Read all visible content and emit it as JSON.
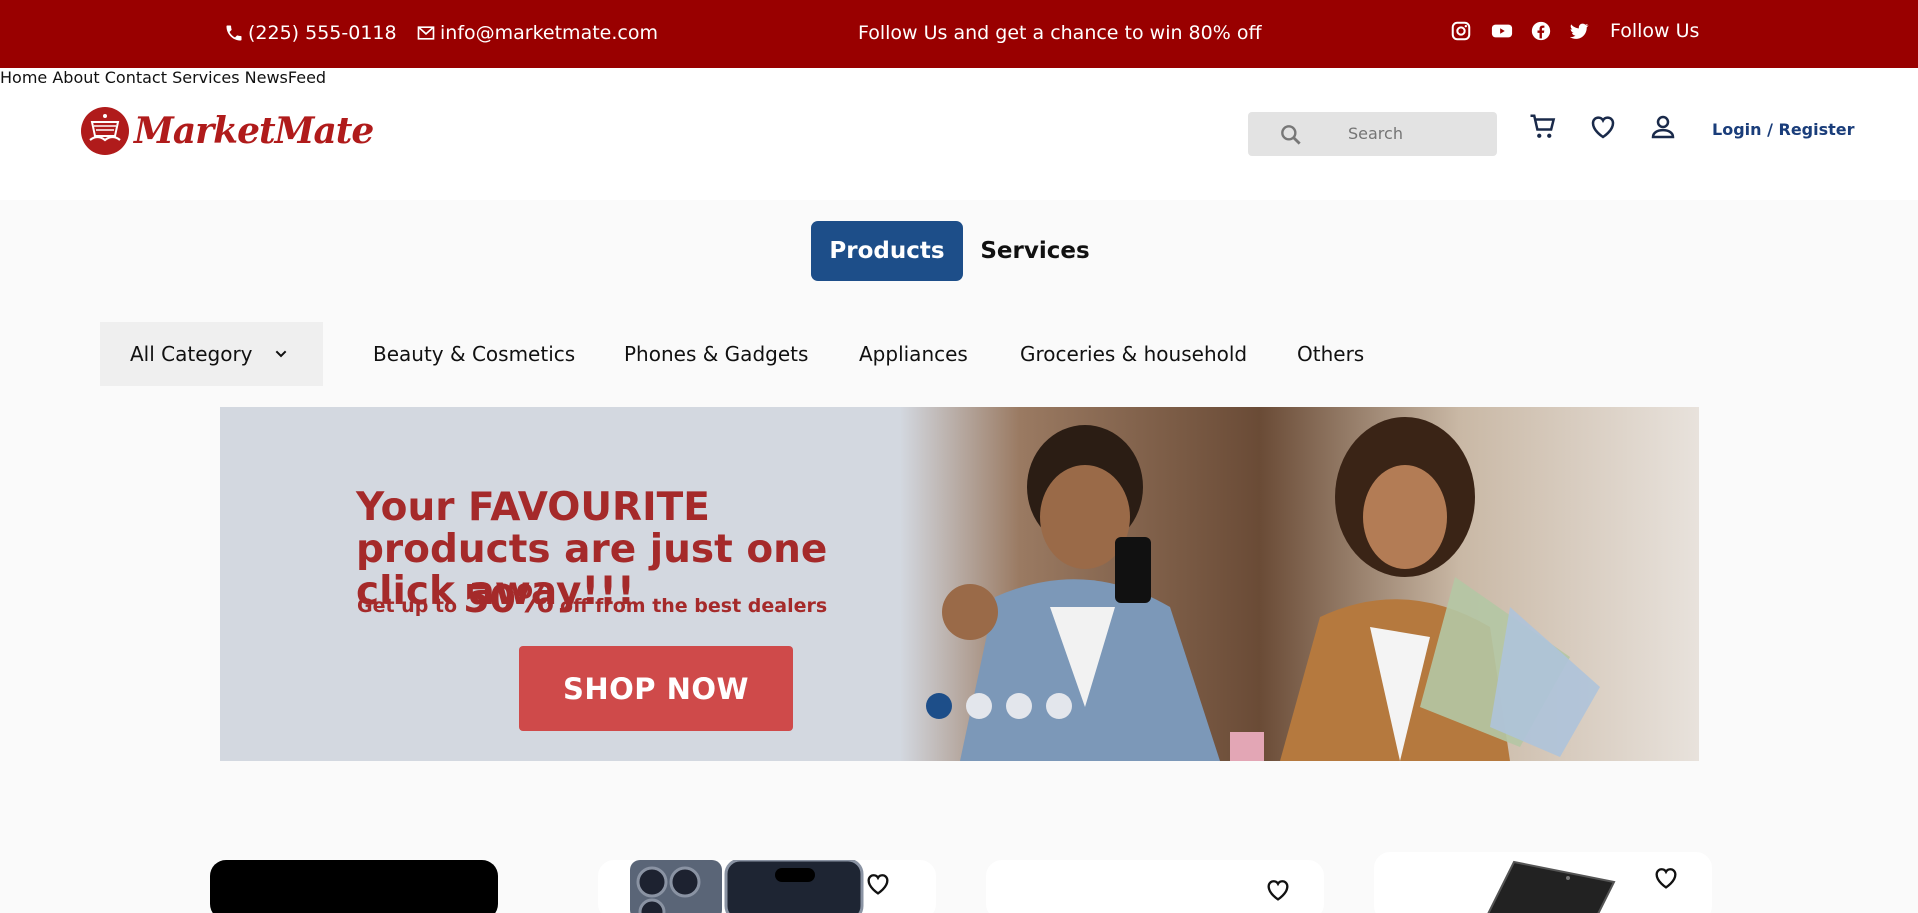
{
  "topbar": {
    "phone": "(225) 555-0118",
    "email": "info@marketmate.com",
    "promo": "Follow Us and get a chance to win 80% off",
    "follow_label": "Follow Us",
    "social_icons": [
      "instagram-icon",
      "youtube-icon",
      "facebook-icon",
      "twitter-icon"
    ]
  },
  "header": {
    "logo_text": "MarketMate",
    "nav": [
      "Home",
      "About",
      "Contact",
      "Services",
      "NewsFeed"
    ],
    "search_placeholder": "Search",
    "icons": [
      "cart-icon",
      "heart-icon",
      "user-icon"
    ],
    "login_label": "Login / Register"
  },
  "tabs": {
    "products": "Products",
    "services": "Services",
    "active": "Products"
  },
  "categories": {
    "all_label": "All Category",
    "items": [
      "Beauty & Cosmetics",
      "Phones & Gadgets",
      "Appliances",
      "Groceries & household",
      "Others"
    ]
  },
  "banner": {
    "headline": "Your FAVOURITE products are just one click away!!!",
    "sub_prefix": "Get up to",
    "sub_big": "50%",
    "sub_suffix": "off from the best dealers",
    "cta": "SHOP NOW",
    "slides": 4,
    "active_slide": 1
  },
  "colors": {
    "topbar": "#990000",
    "brand_red": "#b01b1b",
    "primary_blue": "#1d4e89",
    "cta_red": "#cf4a4a",
    "banner_bg": "#d3d8e0"
  }
}
